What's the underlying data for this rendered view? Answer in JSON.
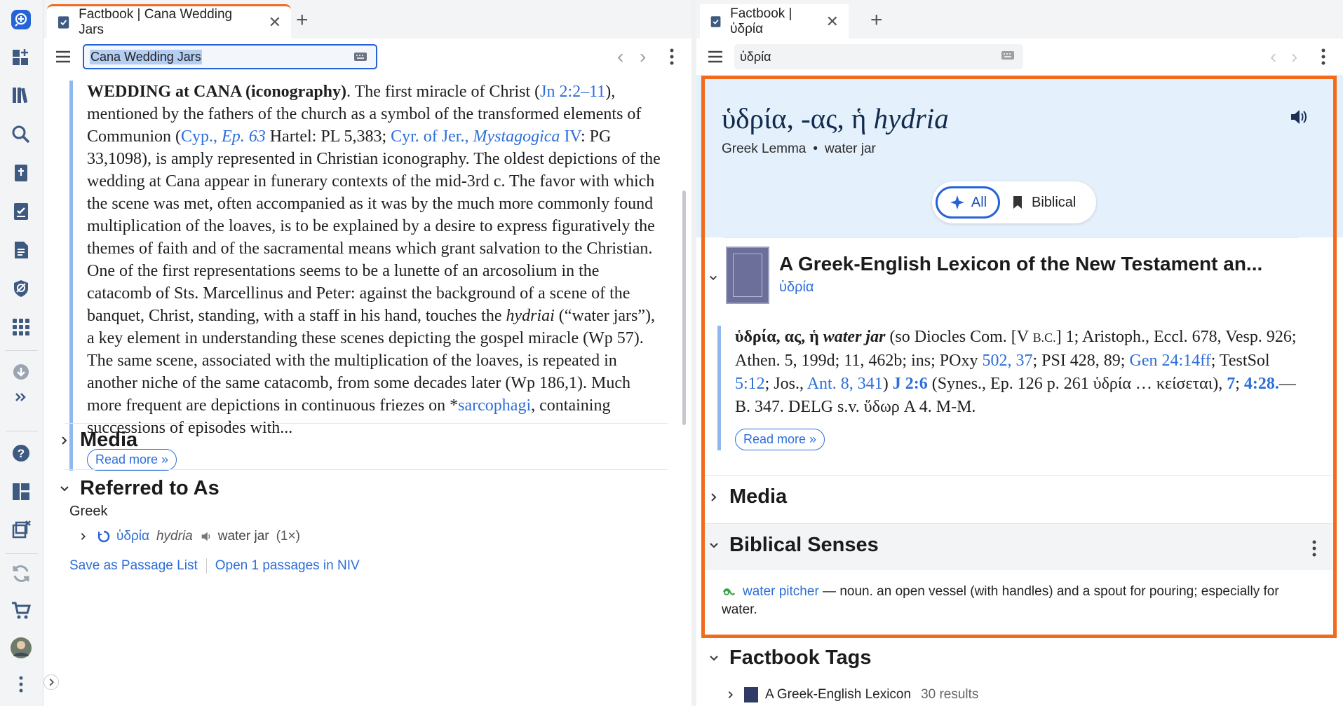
{
  "left": {
    "tab_title": "Factbook | Cana Wedding Jars",
    "search_value": "Cana Wedding Jars",
    "article": {
      "t1": "WEDDING at CANA (iconography)",
      "t2": ". The first miracle of Christ (",
      "link_jn": "Jn 2:2–11",
      "t3": "), mentioned by the fathers of the church as a symbol of the transformed elements of Communion (",
      "link_cyp": "Cyp.,",
      "link_ep": "Ep. 63",
      "t4": " Hartel: PL 5,383; ",
      "link_cyr": "Cyr. of Jer.,",
      "link_myst": "Mystagogica",
      "link_iv": "IV",
      "t5": ": PG 33,1098), is amply represented in Christian iconography. The oldest depictions of the wedding at Cana appear in funerary contexts of the mid-3rd c. The favor with which the scene was met, often accompanied as it was by the much more commonly found multiplication of the loaves, is to be explained by a desire to express figuratively the themes of faith and of the sacramental means which grant salvation to the Christian. One of the first representations seems to be a lunette of an arcosolium in the catacomb of Sts. Marcellinus and Peter: against the background of a scene of the banquet, Christ, standing, with a staff in his hand, touches the ",
      "hydriai": "hydriai",
      "t6": " (“water jars”), a key element in understanding these scenes depicting the gospel miracle (Wp 57). The same scene, associated with the multiplication of the loaves, is repeated in another niche of the same catacomb, from some decades later (Wp 186,1). Much more frequent are depictions in continuous friezes on *",
      "link_sarc": "sarcophagi",
      "t7": ", containing successions of episodes with..."
    },
    "read_more": "Read more »",
    "media_heading": "Media",
    "referred_heading": "Referred to As",
    "greek_label": "Greek",
    "ref_lemma": "ὑδρία",
    "ref_translit": "hydria",
    "ref_gloss": "water jar",
    "ref_count": "(1×)",
    "save_passage": "Save as Passage List",
    "open_passages": "Open 1 passages in NIV"
  },
  "right": {
    "tab_title": "Factbook | ὑδρία",
    "search_value": "ὑδρία",
    "lemma_title": "ὑδρία, -ας, ἡ ",
    "lemma_translit": "hydria",
    "lemma_type": "Greek Lemma",
    "lemma_gloss": "water jar",
    "filter_all": "All",
    "filter_biblical": "Biblical",
    "book_title": "A Greek-English Lexicon of the New Testament an...",
    "book_sub": "ὑδρία",
    "entry": {
      "head": "ὑδρία, ας, ἡ",
      "gloss": "water jar",
      "t1": " (so Diocles Com. [V ",
      "bc": "B.C.",
      "t2": "] 1; Aristoph., Eccl. 678, Vesp. 926; Athen. 5, 199d; 11, 462b; ins; POxy ",
      "l1": "502, 37",
      "t3": "; PSI 428, 89; ",
      "l2": "Gen 24:14ff",
      "t4": "; TestSol ",
      "l3": "5:12",
      "t5": "; Jos., ",
      "l4": "Ant. 8, 341",
      "t6": ") ",
      "l5": "J 2:6",
      "t7": " (Synes., Ep. 126 p. 261 ὑδρία … κείσεται), ",
      "l6": "7",
      "t8": "; ",
      "l7": "4:28.",
      "t9": "—B. 347. DELG s.v. ὕδωρ A 4. M-M."
    },
    "read_more": "Read more »",
    "media_heading": "Media",
    "senses_heading": "Biblical Senses",
    "sense_link": "water pitcher",
    "sense_text": " — noun. an open vessel (with handles) and a spout for pouring; especially for water.",
    "tags_heading": "Factbook Tags",
    "tag_item": "A Greek-English Lexicon",
    "tag_count": "30 results"
  },
  "colors": {
    "accent": "#2563d6",
    "highlight": "#f26b1d",
    "link": "#2d6ed8",
    "header_bg": "#e4f0fb"
  }
}
